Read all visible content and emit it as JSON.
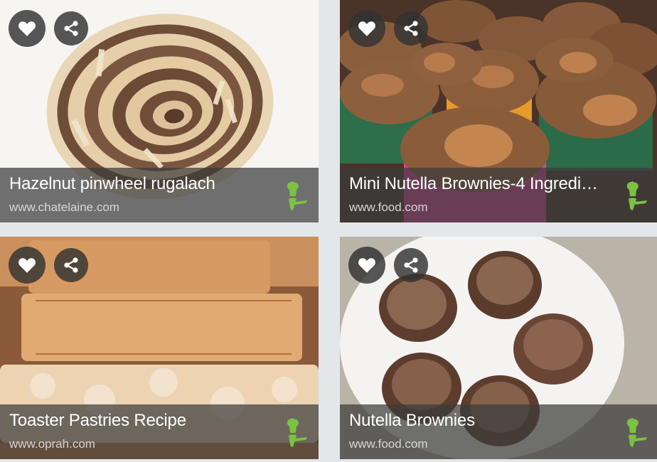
{
  "accent_color": "#7cc242",
  "cards": [
    {
      "title": "Hazelnut pinwheel rugalach",
      "source": "www.chatelaine.com"
    },
    {
      "title": "Mini Nutella Brownies-4 Ingredie...",
      "source": "www.food.com"
    },
    {
      "title": "Toaster Pastries Recipe",
      "source": "www.oprah.com"
    },
    {
      "title": "Nutella Brownies",
      "source": "www.food.com"
    }
  ],
  "icons": {
    "favorite": "heart-icon",
    "share": "share-icon",
    "badge": "chef-icon"
  }
}
